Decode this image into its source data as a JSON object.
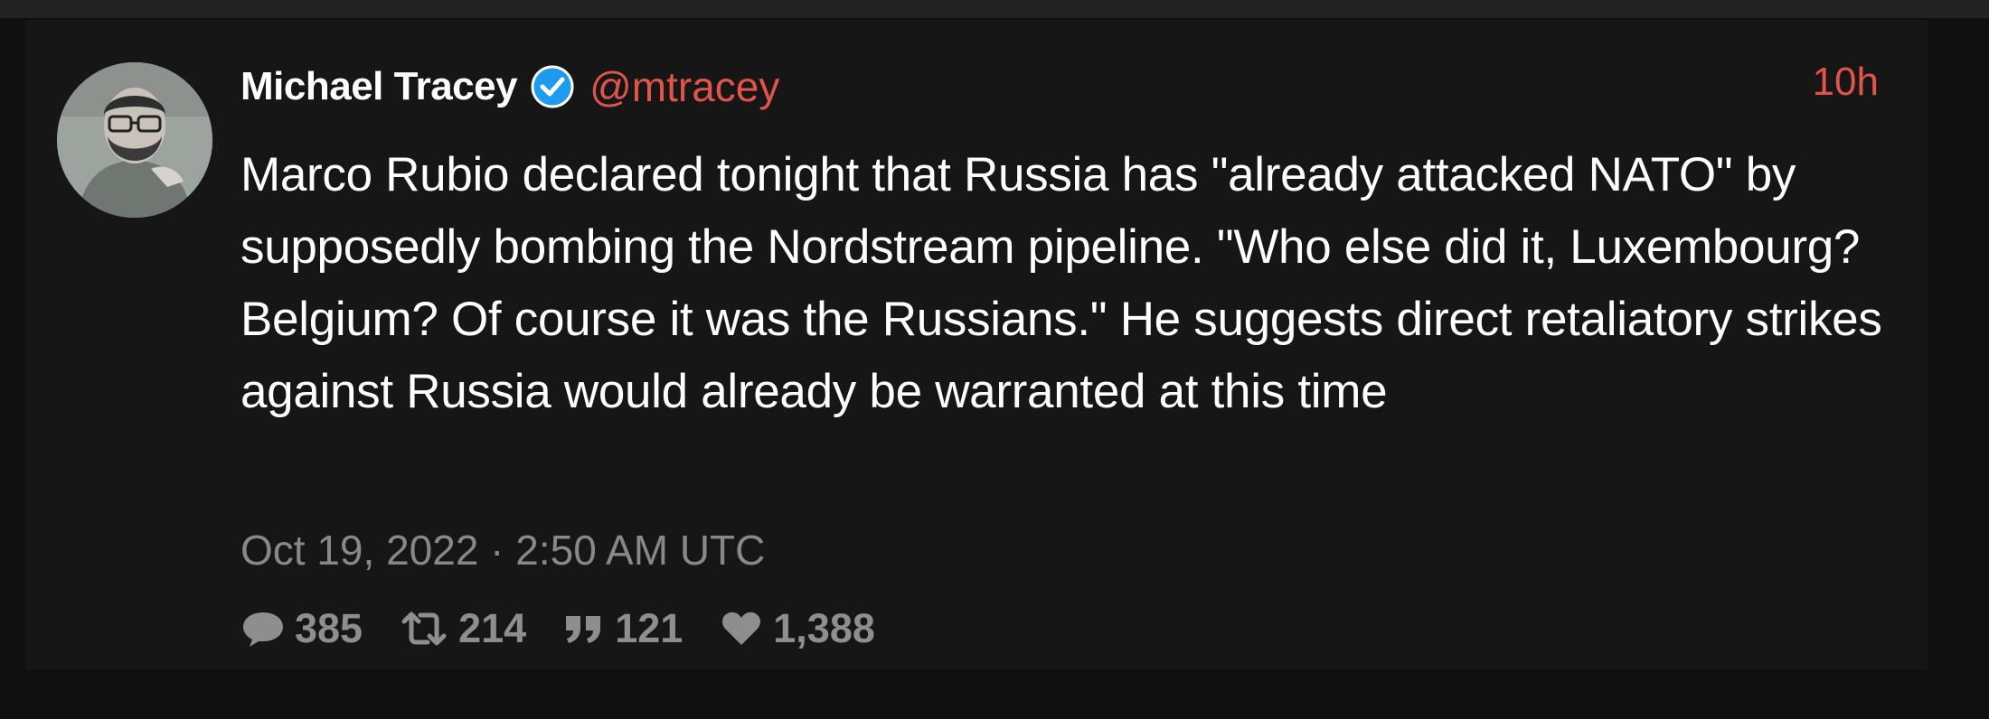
{
  "tweet": {
    "author": {
      "display_name": "Michael Tracey",
      "handle": "@mtracey",
      "verified": true
    },
    "relative_time": "10h",
    "text": "Marco Rubio declared tonight that Russia has \"already attacked NATO\" by supposedly bombing the Nordstream pipeline. \"Who else did it, Luxembourg? Belgium? Of course it was the Russians.\" He suggests direct retaliatory strikes against Russia would already be warranted at this time",
    "date": "Oct 19, 2022 · 2:50 AM UTC",
    "stats": {
      "replies": "385",
      "retweets": "214",
      "quotes": "121",
      "likes": "1,388"
    }
  },
  "icons": {
    "verified": "verified-badge-icon",
    "reply": "comment-icon",
    "retweet": "retweet-icon",
    "quote": "quote-icon",
    "like": "heart-icon"
  },
  "colors": {
    "background": "#0f0f0f",
    "card": "#161616",
    "accent": "#e0544a",
    "verified": "#1d9bf0",
    "text": "#ffffff",
    "muted": "#888888"
  }
}
